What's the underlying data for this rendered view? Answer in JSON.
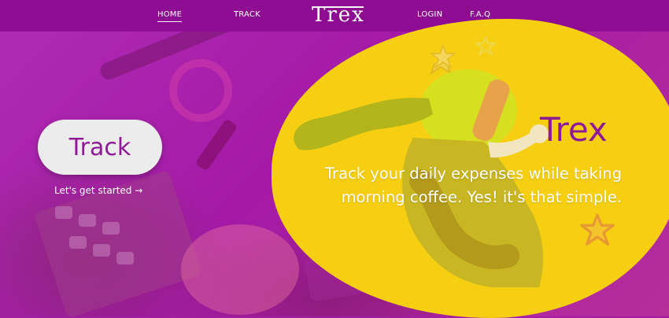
{
  "nav": {
    "home": "HOME",
    "track": "TRACK",
    "logo": "Trex",
    "login": "LOGIN",
    "faq": "F.A.Q"
  },
  "hero": {
    "cta_label": "Track",
    "cta_sub": "Let's get started →",
    "title": "Trex",
    "description": "Track your daily expenses while taking morning coffee. Yes! it's that simple."
  },
  "colors": {
    "nav_bg": "#8e0c92",
    "accent_purple": "#8e1a96",
    "blob_yellow": "#f6cf13"
  }
}
